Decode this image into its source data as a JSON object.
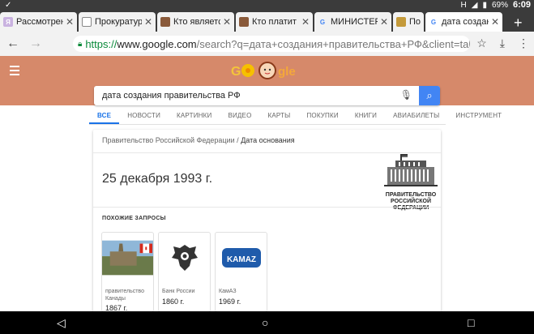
{
  "status": {
    "time": "6:09",
    "battery": "69%",
    "network": "H"
  },
  "tabs": [
    {
      "label": "Рассмотрени",
      "icon": "ru-site-icon",
      "active": false
    },
    {
      "label": "Прокуратура",
      "icon": "doc-icon",
      "active": false
    },
    {
      "label": "Кто является",
      "icon": "site-icon",
      "active": false
    },
    {
      "label": "Кто платит Нд",
      "icon": "site-icon",
      "active": false
    },
    {
      "label": "МИНИСТЕРС",
      "icon": "google-icon",
      "active": false
    },
    {
      "label": "По",
      "icon": "site-icon",
      "active": false
    },
    {
      "label": "дата создани",
      "icon": "google-icon",
      "active": true
    }
  ],
  "omnibox": {
    "scheme": "https://",
    "host": "www.google.com",
    "path": "/search?q=дата+создания+правительства+РФ&client=tablet-android-at"
  },
  "search": {
    "query": "дата создания правительства РФ"
  },
  "google_tabs": [
    "ВСЕ",
    "НОВОСТИ",
    "КАРТИНКИ",
    "ВИДЕО",
    "КАРТЫ",
    "ПОКУПКИ",
    "КНИГИ",
    "АВИАБИЛЕТЫ",
    "ИНСТРУМЕНТ"
  ],
  "card": {
    "breadcrumb_entity": "Правительство Российской Федерации",
    "breadcrumb_sep": "/",
    "breadcrumb_attr": "Дата основания",
    "answer": "25 декабря 1993 г.",
    "logo_text": [
      "ПРАВИТЕЛЬСТВО",
      "РОССИЙСКОЙ",
      "ФЕДЕРАЦИИ"
    ],
    "related_title": "ПОХОЖИЕ ЗАПРОСЫ",
    "related": [
      {
        "name": "правительство Канады",
        "value": "1867 г."
      },
      {
        "name": "Банк России",
        "value": "1860 г."
      },
      {
        "name": "КамАЗ",
        "value": "1969 г."
      }
    ],
    "kamaz_logo_text": "KAMAZ"
  },
  "colors": {
    "header": "#d6896a",
    "accent": "#4285f4"
  }
}
